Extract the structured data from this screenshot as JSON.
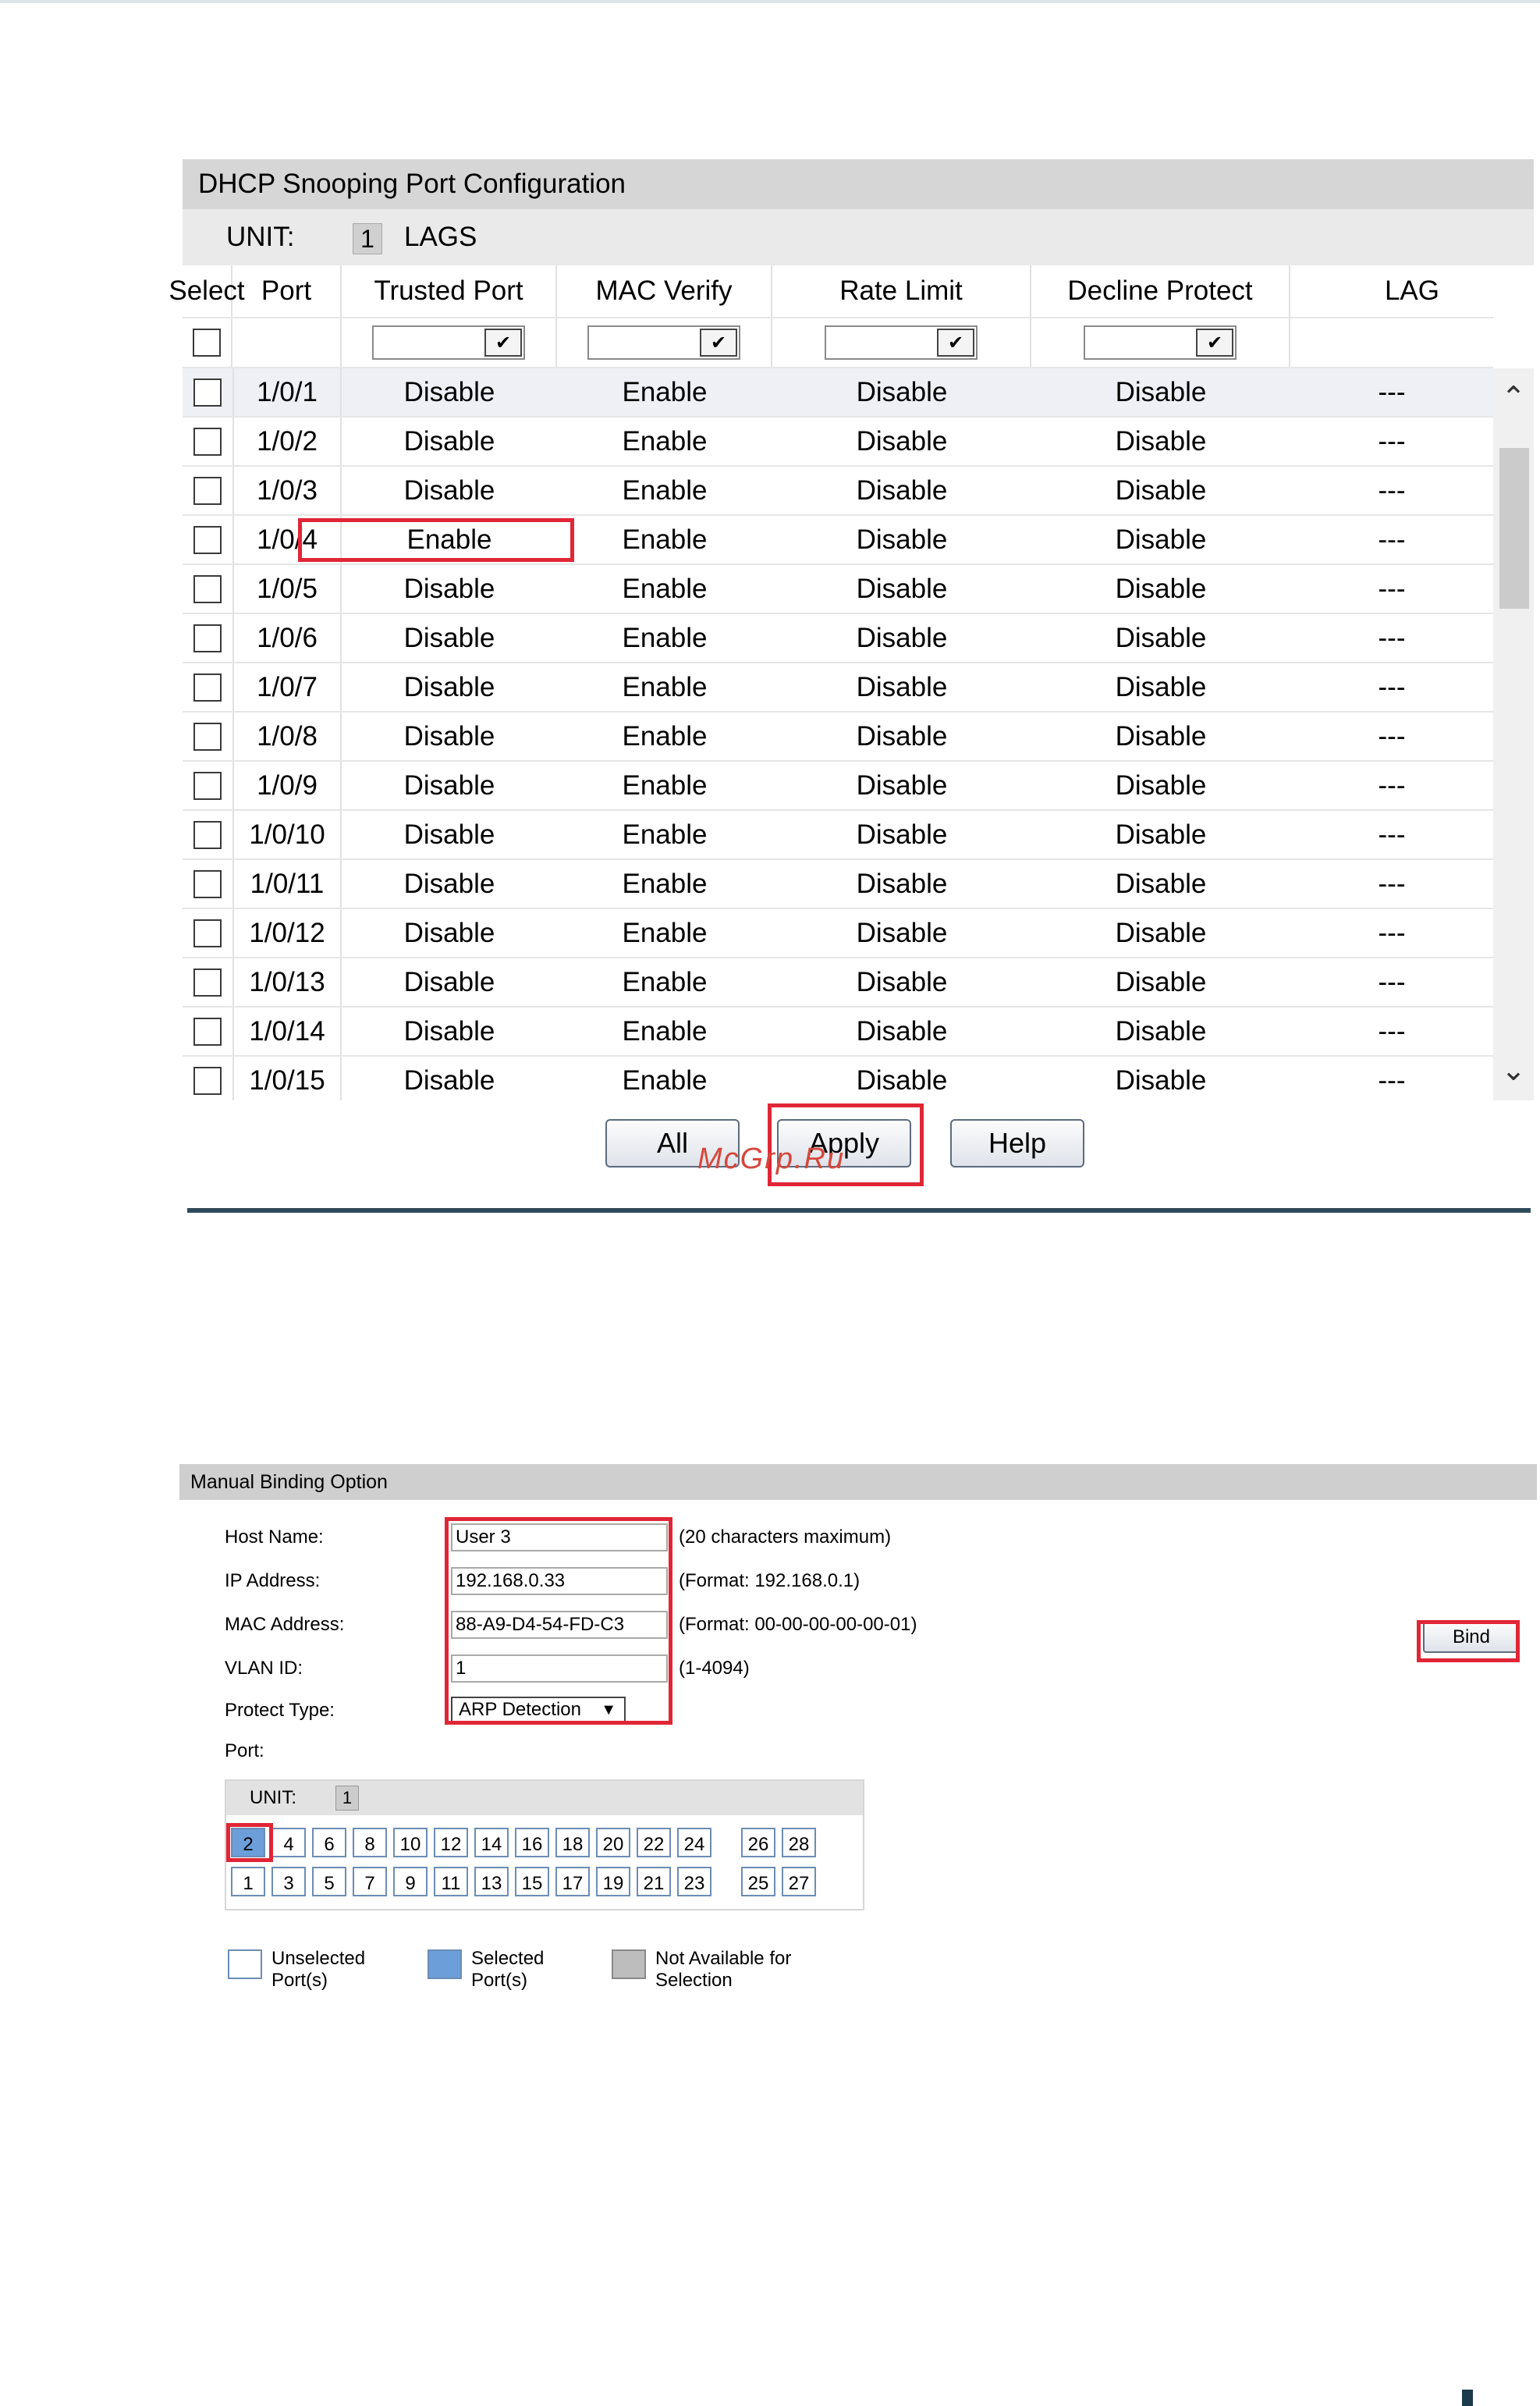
{
  "dhcp_panel": {
    "title": "DHCP Snooping Port Configuration",
    "unit_label": "UNIT:",
    "unit_value": "1",
    "lags_label": "LAGS",
    "columns": [
      "Select",
      "Port",
      "Trusted Port",
      "MAC Verify",
      "Rate Limit",
      "Decline Protect",
      "LAG"
    ],
    "rows": [
      {
        "port": "1/0/1",
        "trusted": "Disable",
        "mac": "Enable",
        "rate": "Disable",
        "decline": "Disable",
        "lag": "---"
      },
      {
        "port": "1/0/2",
        "trusted": "Disable",
        "mac": "Enable",
        "rate": "Disable",
        "decline": "Disable",
        "lag": "---"
      },
      {
        "port": "1/0/3",
        "trusted": "Disable",
        "mac": "Enable",
        "rate": "Disable",
        "decline": "Disable",
        "lag": "---"
      },
      {
        "port": "1/0/4",
        "trusted": "Enable",
        "mac": "Enable",
        "rate": "Disable",
        "decline": "Disable",
        "lag": "---"
      },
      {
        "port": "1/0/5",
        "trusted": "Disable",
        "mac": "Enable",
        "rate": "Disable",
        "decline": "Disable",
        "lag": "---"
      },
      {
        "port": "1/0/6",
        "trusted": "Disable",
        "mac": "Enable",
        "rate": "Disable",
        "decline": "Disable",
        "lag": "---"
      },
      {
        "port": "1/0/7",
        "trusted": "Disable",
        "mac": "Enable",
        "rate": "Disable",
        "decline": "Disable",
        "lag": "---"
      },
      {
        "port": "1/0/8",
        "trusted": "Disable",
        "mac": "Enable",
        "rate": "Disable",
        "decline": "Disable",
        "lag": "---"
      },
      {
        "port": "1/0/9",
        "trusted": "Disable",
        "mac": "Enable",
        "rate": "Disable",
        "decline": "Disable",
        "lag": "---"
      },
      {
        "port": "1/0/10",
        "trusted": "Disable",
        "mac": "Enable",
        "rate": "Disable",
        "decline": "Disable",
        "lag": "---"
      },
      {
        "port": "1/0/11",
        "trusted": "Disable",
        "mac": "Enable",
        "rate": "Disable",
        "decline": "Disable",
        "lag": "---"
      },
      {
        "port": "1/0/12",
        "trusted": "Disable",
        "mac": "Enable",
        "rate": "Disable",
        "decline": "Disable",
        "lag": "---"
      },
      {
        "port": "1/0/13",
        "trusted": "Disable",
        "mac": "Enable",
        "rate": "Disable",
        "decline": "Disable",
        "lag": "---"
      },
      {
        "port": "1/0/14",
        "trusted": "Disable",
        "mac": "Enable",
        "rate": "Disable",
        "decline": "Disable",
        "lag": "---"
      },
      {
        "port": "1/0/15",
        "trusted": "Disable",
        "mac": "Enable",
        "rate": "Disable",
        "decline": "Disable",
        "lag": "---"
      }
    ],
    "buttons": {
      "all": "All",
      "apply": "Apply",
      "help": "Help"
    }
  },
  "watermark": "McGrp.Ru",
  "binding_panel": {
    "title": "Manual Binding Option",
    "fields": {
      "host_name": {
        "label": "Host Name:",
        "value": "User 3",
        "hint": "(20 characters maximum)"
      },
      "ip_address": {
        "label": "IP Address:",
        "value": "192.168.0.33",
        "hint": "(Format: 192.168.0.1)"
      },
      "mac_address": {
        "label": "MAC Address:",
        "value": "88-A9-D4-54-FD-C3",
        "hint": "(Format: 00-00-00-00-00-01)"
      },
      "vlan_id": {
        "label": "VLAN ID:",
        "value": "1",
        "hint": "(1-4094)"
      },
      "protect_type": {
        "label": "Protect Type:",
        "value": "ARP Detection"
      }
    },
    "port_label": "Port:",
    "unit_label": "UNIT:",
    "unit_value": "1",
    "ports_top": [
      "2",
      "4",
      "6",
      "8",
      "10",
      "12",
      "14",
      "16",
      "18",
      "20",
      "22",
      "24",
      "26",
      "28"
    ],
    "ports_bottom": [
      "1",
      "3",
      "5",
      "7",
      "9",
      "11",
      "13",
      "15",
      "17",
      "19",
      "21",
      "23",
      "25",
      "27"
    ],
    "selected_port": "2",
    "legend": {
      "unselected": "Unselected\nPort(s)",
      "selected": "Selected\nPort(s)",
      "not_available": "Not Available for\nSelection"
    },
    "bind_button": "Bind"
  },
  "colors": {
    "highlight": "#e02636",
    "selected_port": "#6c9fd9",
    "separator": "#2f4a5b"
  }
}
